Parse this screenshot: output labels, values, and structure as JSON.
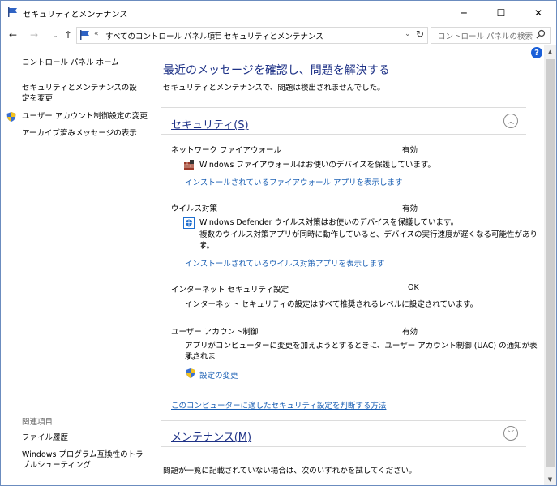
{
  "window": {
    "title": "セキュリティとメンテナンス",
    "minimize_glyph": "─",
    "maximize_glyph": "☐",
    "close_glyph": "✕"
  },
  "nav": {
    "back_glyph": "←",
    "forward_glyph": "→",
    "recent_glyph": "⌄",
    "up_glyph": "↑"
  },
  "address": {
    "separator": "«",
    "crumbs": [
      "すべてのコントロール パネル項目",
      "セキュリティとメンテナンス"
    ],
    "crumb_arrow": "›",
    "dropdown_glyph": "⌄",
    "refresh_glyph": "↻"
  },
  "search": {
    "placeholder": "コントロール パネルの検索",
    "icon": "search-icon"
  },
  "left_pane": {
    "home": "コントロール パネル ホーム",
    "settings": "セキュリティとメンテナンスの設定を変更",
    "uac": "ユーザー アカウント制御設定の変更",
    "archive": "アーカイブ済みメッセージの表示",
    "related_heading": "関連項目",
    "file_history": "ファイル履歴",
    "compat": "Windows プログラム互換性のトラブルシューティング"
  },
  "main": {
    "heading": "最近のメッセージを確認し、問題を解決する",
    "subtitle": "セキュリティとメンテナンスで、問題は検出されませんでした。",
    "security": {
      "title": "セキュリティ(S)",
      "toggle_glyph": "︿",
      "firewall": {
        "name": "ネットワーク ファイアウォール",
        "status": "有効",
        "message": "Windows ファイアウォールはお使いのデバイスを保護しています。",
        "link": "インストールされているファイアウォール アプリを表示します"
      },
      "virus": {
        "name": "ウイルス対策",
        "status": "有効",
        "message": "Windows Defender ウイルス対策はお使いのデバイスを保護しています。",
        "message2": "複数のウイルス対策アプリが同時に動作していると、デバイスの実行速度が遅くなる可能性がありま",
        "message3": "す。",
        "link": "インストールされているウイルス対策アプリを表示します"
      },
      "internet": {
        "name": "インターネット セキュリティ設定",
        "status": "OK",
        "message": "インターネット セキュリティの設定はすべて推奨されるレベルに設定されています。"
      },
      "uac": {
        "name": "ユーザー アカウント制御",
        "status": "有効",
        "message": "アプリがコンピューターに変更を加えようとするときに、ユーザー アカウント制御 (UAC) の通知が表示されま",
        "message2": "す。",
        "link": "設定の変更"
      },
      "bottom_link": "このコンピューターに適したセキュリティ設定を判断する方法"
    },
    "maintenance": {
      "title": "メンテナンス(M)",
      "toggle_glyph": "﹀"
    },
    "footer": "問題が一覧に記載されていない場合は、次のいずれかを試してください。"
  },
  "scrollbar": {
    "up_glyph": "▲",
    "down_glyph": "▼"
  },
  "help": "?",
  "colors": {
    "accent_heading": "#1e3287",
    "link": "#1a5fb4",
    "help": "#1a5fd8"
  }
}
